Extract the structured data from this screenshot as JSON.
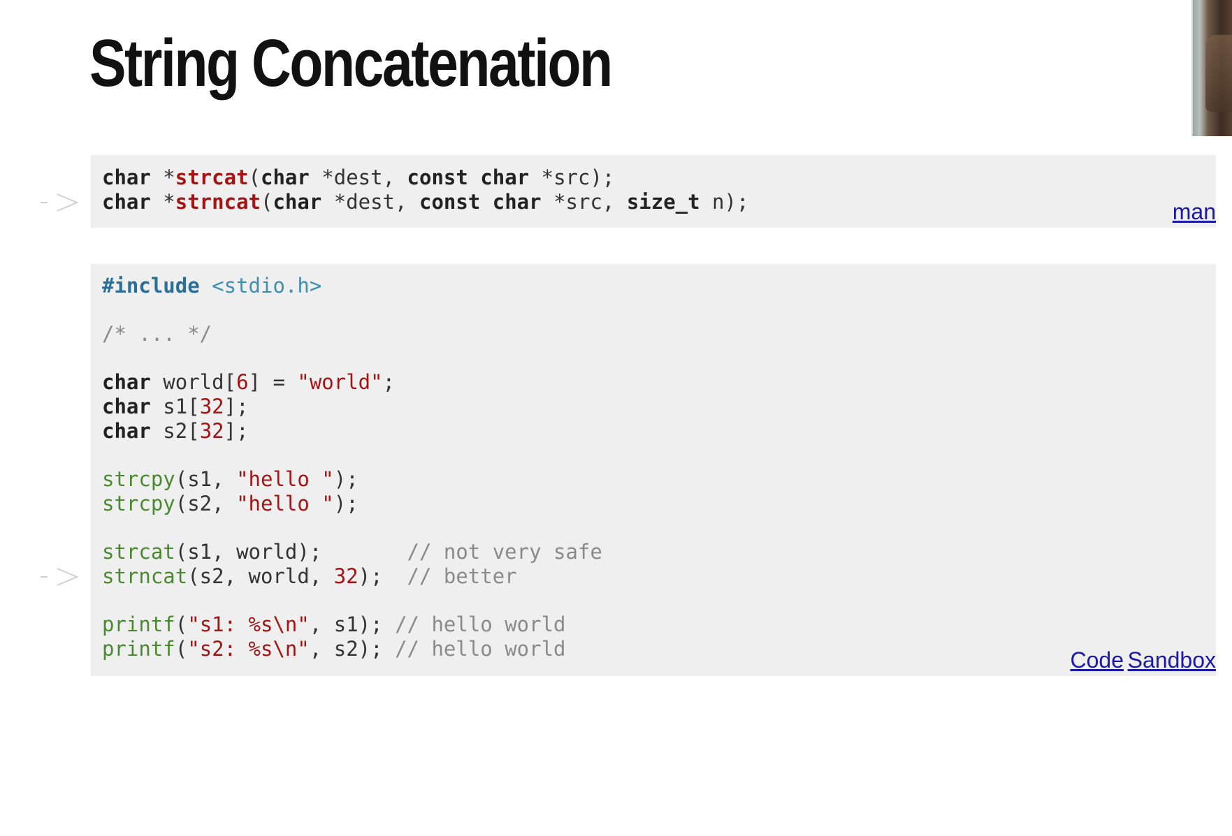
{
  "slide": {
    "title": "String Concatenation"
  },
  "signatures": {
    "line1": {
      "ret": "char",
      "star": " *",
      "fn": "strcat",
      "open": "(",
      "t1": "char",
      "p1": " *dest, ",
      "q2": "const",
      "sp": " ",
      "t2": "char",
      "p2": " *src);"
    },
    "line2": {
      "ret": "char",
      "star": " *",
      "fn": "strncat",
      "open": "(",
      "t1": "char",
      "p1": " *dest, ",
      "q2": "const",
      "sp": " ",
      "t2": "char",
      "p2": " *src, ",
      "t3": "size_t",
      "p3": " n);"
    },
    "man_link": "man"
  },
  "example": {
    "include_kw": "#include",
    "include_hdr": " <stdio.h>",
    "comment": "/* ... */",
    "decl_world": {
      "kw": "char",
      "a": " world[",
      "n": "6",
      "b": "] = ",
      "s": "\"world\"",
      "c": ";"
    },
    "decl_s1": {
      "kw": "char",
      "a": " s1[",
      "n": "32",
      "b": "];"
    },
    "decl_s2": {
      "kw": "char",
      "a": " s2[",
      "n": "32",
      "b": "];"
    },
    "cpy1": {
      "call": "strcpy",
      "a": "(s1, ",
      "s": "\"hello \"",
      "b": ");"
    },
    "cpy2": {
      "call": "strcpy",
      "a": "(s2, ",
      "s": "\"hello \"",
      "b": ");"
    },
    "cat1": {
      "call": "strcat",
      "a": "(s1, world);       ",
      "c": "// not very safe"
    },
    "cat2": {
      "call": "strncat",
      "a": "(s2, world, ",
      "n": "32",
      "b": ");  ",
      "c": "// better"
    },
    "print1": {
      "call": "printf",
      "a": "(",
      "s": "\"s1: %s\\n\"",
      "b": ", s1); ",
      "c": "// hello world"
    },
    "print2": {
      "call": "printf",
      "a": "(",
      "s": "\"s2: %s\\n\"",
      "b": ", s2); ",
      "c": "// hello world"
    },
    "code_link": "Code",
    "sandbox_link": "Sandbox"
  },
  "colors": {
    "panel_bg": "#efefef",
    "link": "#1a1aa6",
    "keyword_fn": "#a31515",
    "call": "#4a8a2f",
    "comment": "#8a8a8a"
  }
}
